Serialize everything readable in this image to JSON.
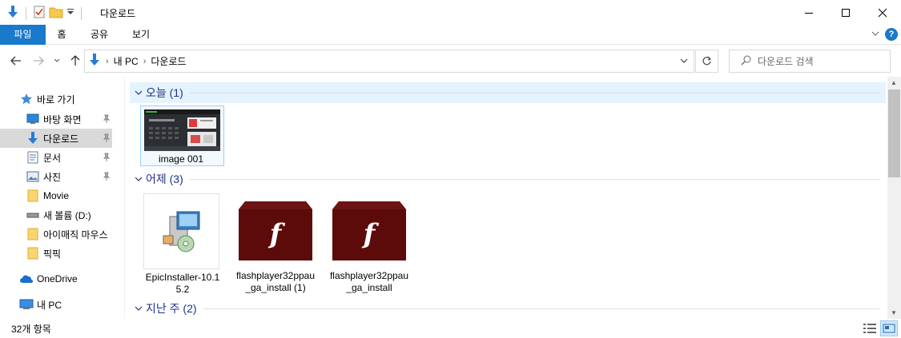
{
  "window": {
    "title": "다운로드"
  },
  "ribbon": {
    "tabs": [
      {
        "label": "파일"
      },
      {
        "label": "홈"
      },
      {
        "label": "공유"
      },
      {
        "label": "보기"
      }
    ]
  },
  "address": {
    "crumbs": [
      "내 PC",
      "다운로드"
    ]
  },
  "search": {
    "placeholder": "다운로드 검색"
  },
  "navpane": {
    "items": [
      {
        "label": "바로 가기",
        "icon": "star-icon"
      },
      {
        "label": "바탕 화면",
        "icon": "desktop-icon",
        "pinned": true
      },
      {
        "label": "다운로드",
        "icon": "download-icon",
        "pinned": true,
        "selected": true
      },
      {
        "label": "문서",
        "icon": "document-icon",
        "pinned": true
      },
      {
        "label": "사진",
        "icon": "pictures-icon",
        "pinned": true
      },
      {
        "label": "Movie",
        "icon": "folder-icon"
      },
      {
        "label": "새 볼륨 (D:)",
        "icon": "drive-icon"
      },
      {
        "label": "아이매직 마우스",
        "icon": "folder-icon"
      },
      {
        "label": "픽픽",
        "icon": "folder-icon"
      },
      {
        "label": "OneDrive",
        "icon": "cloud-icon"
      },
      {
        "label": "내 PC",
        "icon": "computer-icon"
      }
    ]
  },
  "groups": [
    {
      "label": "오늘 (1)",
      "items": [
        {
          "name": "image 001"
        }
      ]
    },
    {
      "label": "어제 (3)",
      "items": [
        {
          "name": "EpicInstaller-10.15.2"
        },
        {
          "name": "flashplayer32ppau_ga_install (1)"
        },
        {
          "name": "flashplayer32ppau_ga_install"
        }
      ]
    },
    {
      "label": "지난 주 (2)",
      "items": []
    }
  ],
  "status": {
    "count": "32개 항목"
  },
  "colors": {
    "accent": "#1979ca",
    "group_header": "#1e3287",
    "selected_bg": "#d9d9d9",
    "flash_red": "#5c0a0a"
  }
}
